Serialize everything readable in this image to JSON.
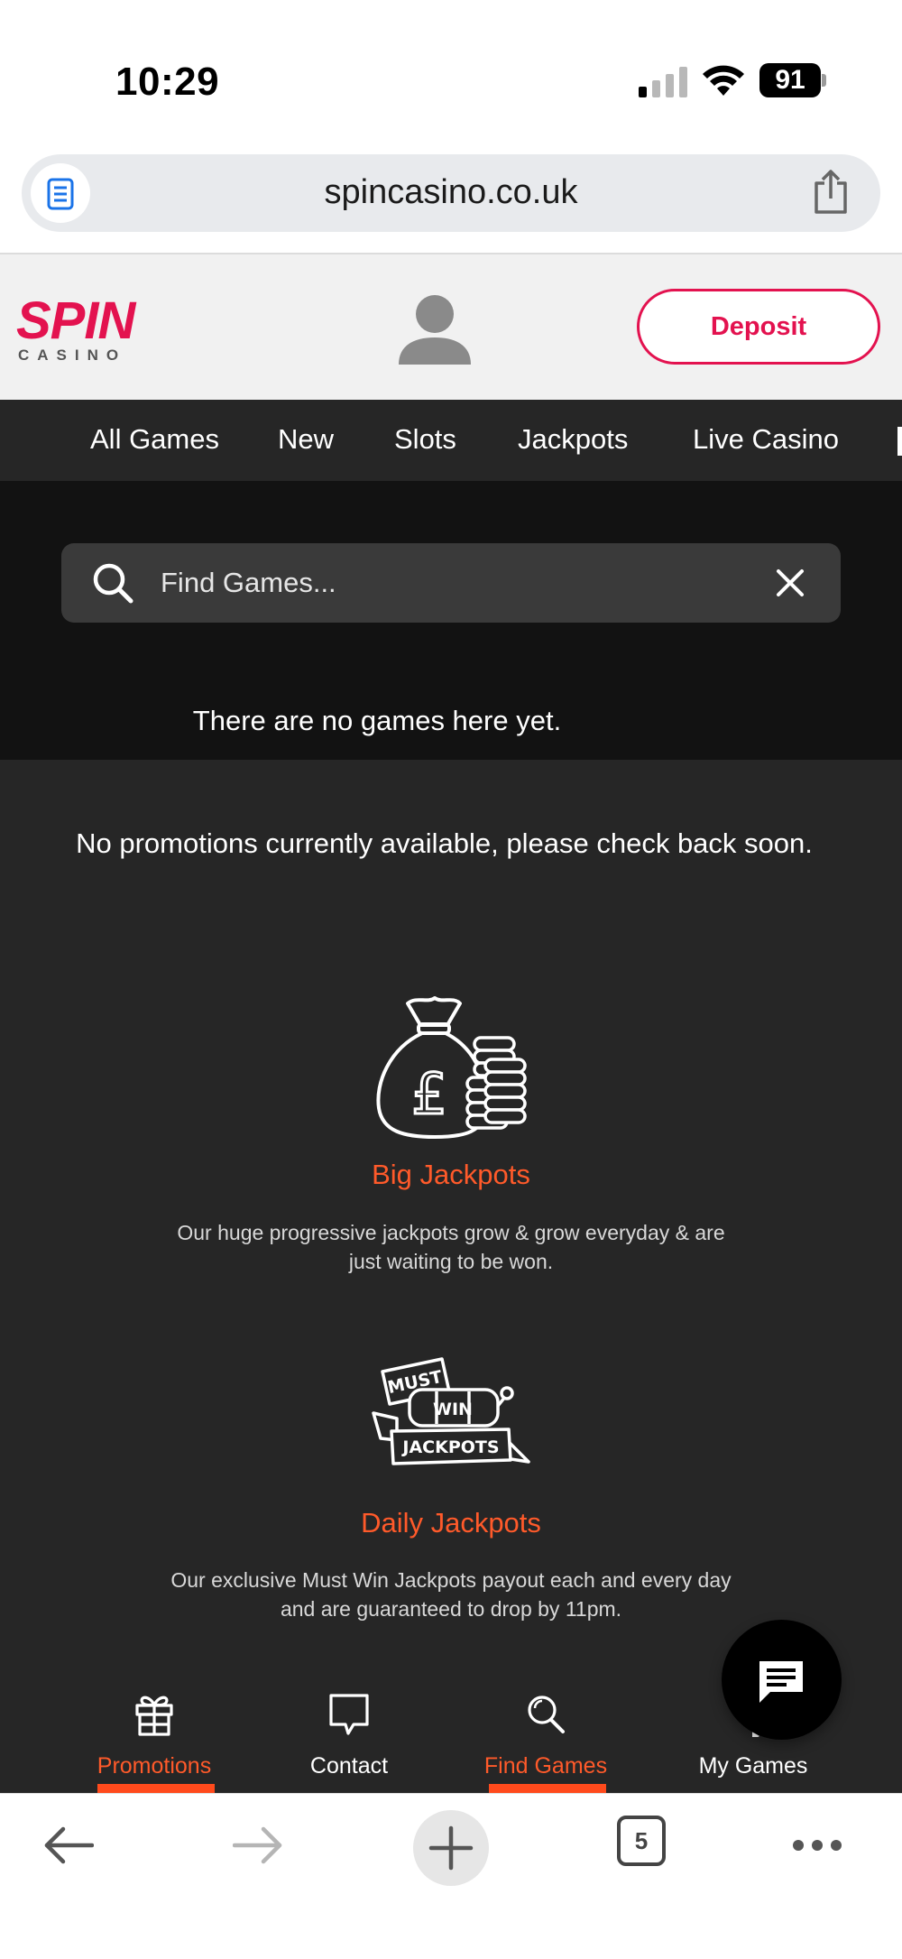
{
  "status_bar": {
    "time": "10:29",
    "battery": "91"
  },
  "browser": {
    "url": "spincasino.co.uk",
    "tab_count": "5"
  },
  "header": {
    "logo_main": "SPIN",
    "logo_sub": "CASINO",
    "deposit_label": "Deposit"
  },
  "categories": [
    "All Games",
    "New",
    "Slots",
    "Jackpots",
    "Live Casino"
  ],
  "search": {
    "placeholder": "Find Games...",
    "empty_message": "There are no games here yet."
  },
  "promotions": {
    "empty_message": "No promotions currently available, please check back soon."
  },
  "features": [
    {
      "title": "Big Jackpots",
      "description": "Our huge progressive jackpots grow & grow everyday & are just waiting to be won.",
      "icon": "money-bag-icon"
    },
    {
      "title": "Daily Jackpots",
      "description": "Our exclusive Must Win Jackpots payout each and every day and are guaranteed to drop by 11pm.",
      "icon": "must-win-jackpots-icon",
      "badge_lines": [
        "MUST",
        "WIN",
        "JACKPOTS"
      ]
    }
  ],
  "bottom_nav": [
    {
      "label": "Promotions",
      "icon": "gift-icon",
      "active": true
    },
    {
      "label": "Contact",
      "icon": "chat-bubble-icon",
      "active": false
    },
    {
      "label": "Find Games",
      "icon": "search-icon",
      "active": true
    },
    {
      "label": "My Games",
      "icon": "play-icon",
      "active": false
    }
  ],
  "colors": {
    "brand": "#e3124f",
    "accent": "#ff5a2a",
    "nav_bg": "#262626",
    "search_bg": "#121212"
  }
}
